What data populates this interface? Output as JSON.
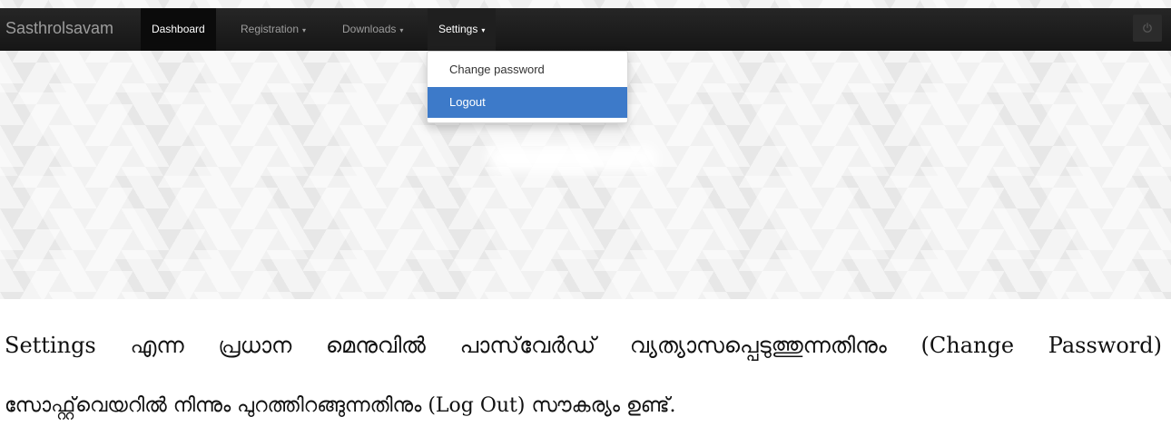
{
  "navbar": {
    "brand": "Sasthrolsavam",
    "items": [
      {
        "label": "Dashboard",
        "state": "active"
      },
      {
        "label": "Registration",
        "caret": "▾"
      },
      {
        "label": "Downloads",
        "caret": "▾"
      },
      {
        "label": "Settings",
        "caret": "▾",
        "state": "open"
      }
    ],
    "power_icon": "power-icon"
  },
  "dropdown": {
    "items": [
      {
        "label": "Change password"
      },
      {
        "label": "Logout",
        "state": "highlighted"
      }
    ]
  },
  "caption": {
    "line1": [
      "Settings",
      "എന്ന",
      "പ്രധാന",
      "മെനുവിൽ",
      "പാസ്‌വേർഡ്",
      "വ്യത്യാസപ്പെടുത്തുന്നതിനും",
      "(Change",
      "Password)"
    ],
    "line2": "സോഫ്റ്റ്‌വെയറിൽ നിന്നും പുറത്തിറങ്ങുന്നതിനും (Log Out)  സൗകര്യം ഉണ്ട്."
  },
  "colors": {
    "navbar": "#1a1a1a",
    "active_item": "#0b0b0b",
    "highlight": "#3d7ac9",
    "nav_text": "#9d9d9d"
  }
}
